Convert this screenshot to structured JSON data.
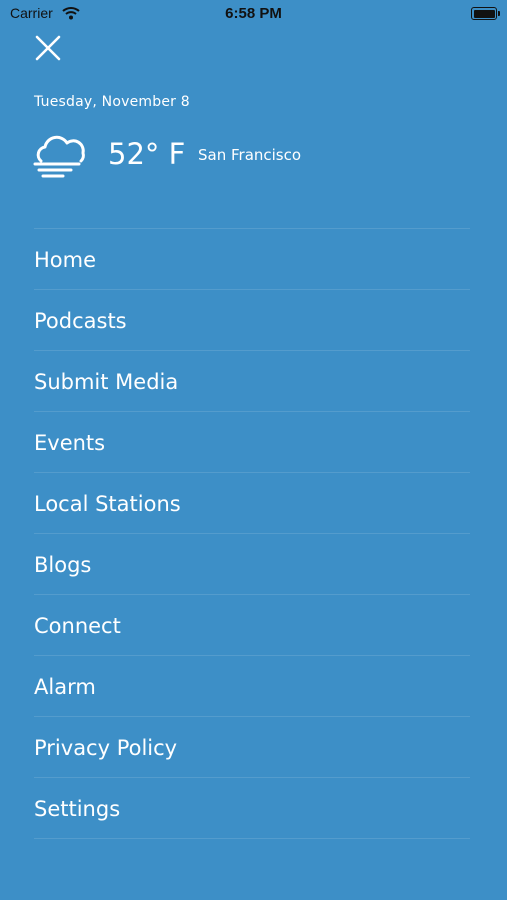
{
  "status_bar": {
    "carrier": "Carrier",
    "time": "6:58 PM",
    "wifi_icon": "wifi-icon",
    "battery_icon": "battery-icon"
  },
  "header": {
    "close_icon": "close-icon",
    "date": "Tuesday, November 8",
    "weather_icon": "cloud-fog-icon",
    "temperature": "52° F",
    "city": "San Francisco"
  },
  "menu": {
    "items": [
      {
        "label": "Home"
      },
      {
        "label": "Podcasts"
      },
      {
        "label": "Submit Media"
      },
      {
        "label": "Events"
      },
      {
        "label": "Local Stations"
      },
      {
        "label": "Blogs"
      },
      {
        "label": "Connect"
      },
      {
        "label": "Alarm"
      },
      {
        "label": "Privacy Policy"
      },
      {
        "label": "Settings"
      }
    ]
  },
  "colors": {
    "background": "#3d8fc7",
    "text": "#ffffff"
  }
}
